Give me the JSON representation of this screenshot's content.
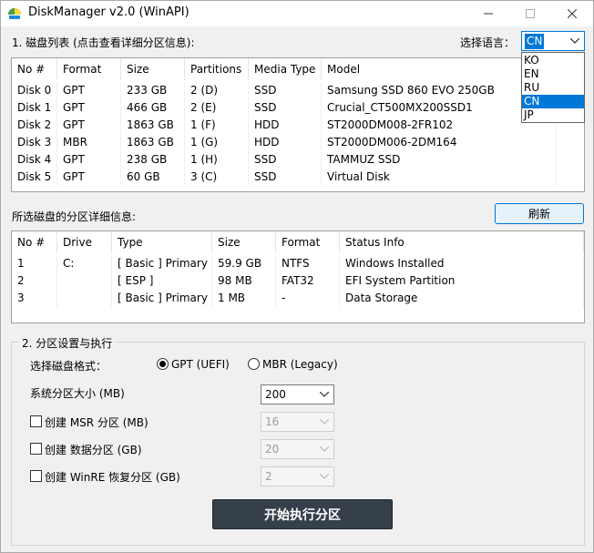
{
  "window": {
    "title": "DiskManager v2.0 (WinAPI)",
    "min_glyph": "—",
    "max_glyph": "☐",
    "close_glyph": "✕"
  },
  "disk_section": {
    "label": "1. 磁盘列表 (点击查看详细分区信息):",
    "columns": [
      "No #",
      "Format",
      "Size",
      "Partitions",
      "Media Type",
      "Model"
    ],
    "rows": [
      [
        "Disk 0",
        "GPT",
        "233 GB",
        "2 (D)",
        "SSD",
        "Samsung SSD 860 EVO 250GB"
      ],
      [
        "Disk 1",
        "GPT",
        "466 GB",
        "2 (E)",
        "SSD",
        "Crucial_CT500MX200SSD1"
      ],
      [
        "Disk 2",
        "GPT",
        "1863 GB",
        "1 (F)",
        "HDD",
        "ST2000DM008-2FR102"
      ],
      [
        "Disk 3",
        "MBR",
        "1863 GB",
        "1 (G)",
        "HDD",
        "ST2000DM006-2DM164"
      ],
      [
        "Disk 4",
        "GPT",
        "238 GB",
        "1 (H)",
        "SSD",
        "TAMMUZ SSD"
      ],
      [
        "Disk 5",
        "GPT",
        "60 GB",
        "3 (C)",
        "SSD",
        "Virtual Disk"
      ]
    ]
  },
  "language": {
    "label": "选择语言：",
    "selected": "CN",
    "options": [
      "KO",
      "EN",
      "RU",
      "CN",
      "JP"
    ]
  },
  "partition_section": {
    "label": "所选磁盘的分区详细信息:",
    "refresh_label": "刷新",
    "columns": [
      "No #",
      "Drive",
      "Type",
      "Size",
      "Format",
      "Status Info"
    ],
    "rows": [
      [
        "1",
        "C:",
        "[ Basic ] Primary",
        "59.9 GB",
        "NTFS",
        "Windows Installed"
      ],
      [
        "2",
        "",
        "[ ESP ]",
        "98 MB",
        "FAT32",
        "EFI System Partition"
      ],
      [
        "3",
        "",
        "[ Basic ] Primary",
        "1 MB",
        "-",
        "Data Storage"
      ]
    ]
  },
  "settings": {
    "group_title": "2. 分区设置与执行",
    "format_label": "选择磁盘格式：",
    "gpt_label": "GPT (UEFI)",
    "mbr_label": "MBR (Legacy)",
    "sys_size_label": "系统分区大小 (MB)",
    "sys_size_value": "200",
    "msr_label": "创建 MSR 分区 (MB)",
    "msr_value": "16",
    "data_label": "创建 数据分区 (GB)",
    "data_value": "20",
    "winre_label": "创建 WinRE 恢复分区 (GB)",
    "winre_value": "2",
    "start_label": "开始执行分区"
  }
}
